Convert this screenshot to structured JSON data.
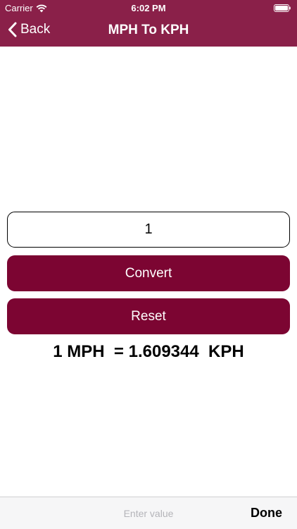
{
  "status_bar": {
    "carrier": "Carrier",
    "time": "6:02 PM"
  },
  "nav": {
    "back_label": "Back",
    "title": "MPH To KPH"
  },
  "input": {
    "value": "1"
  },
  "buttons": {
    "convert_label": "Convert",
    "reset_label": "Reset"
  },
  "result": {
    "text": "1 MPH  = 1.609344  KPH"
  },
  "accessory_bar": {
    "placeholder": "Enter value",
    "done_label": "Done"
  },
  "colors": {
    "nav_background": "#8a2049",
    "button_background": "#7c0532",
    "caret": "#3478f6"
  }
}
